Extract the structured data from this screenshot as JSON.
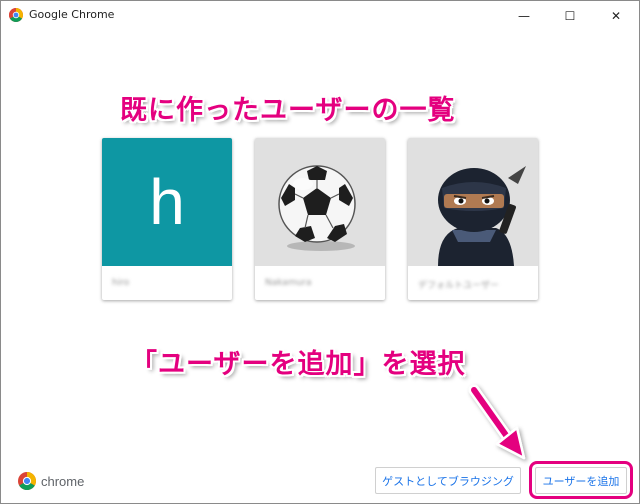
{
  "window": {
    "title": "Google Chrome",
    "minimize_glyph": "—",
    "maximize_glyph": "☐",
    "close_glyph": "✕"
  },
  "annotations": {
    "top_label": "既に作ったユーザーの一覧",
    "bottom_label": "「ユーザーを追加」を選択",
    "color": "#e4007f"
  },
  "profiles": [
    {
      "avatar": "h",
      "avatar_color": "#0e97a3",
      "name": "hiro"
    },
    {
      "avatar": "soccer-ball-icon",
      "avatar_color": "#e0e0e0",
      "name": "Nakamura"
    },
    {
      "avatar": "ninja-icon",
      "avatar_color": "#e0e0e0",
      "name": "デフォルトユーザー"
    }
  ],
  "footer": {
    "brand": "chrome",
    "guest_button": "ゲストとしてブラウジング",
    "add_user_button": "ユーザーを追加"
  }
}
